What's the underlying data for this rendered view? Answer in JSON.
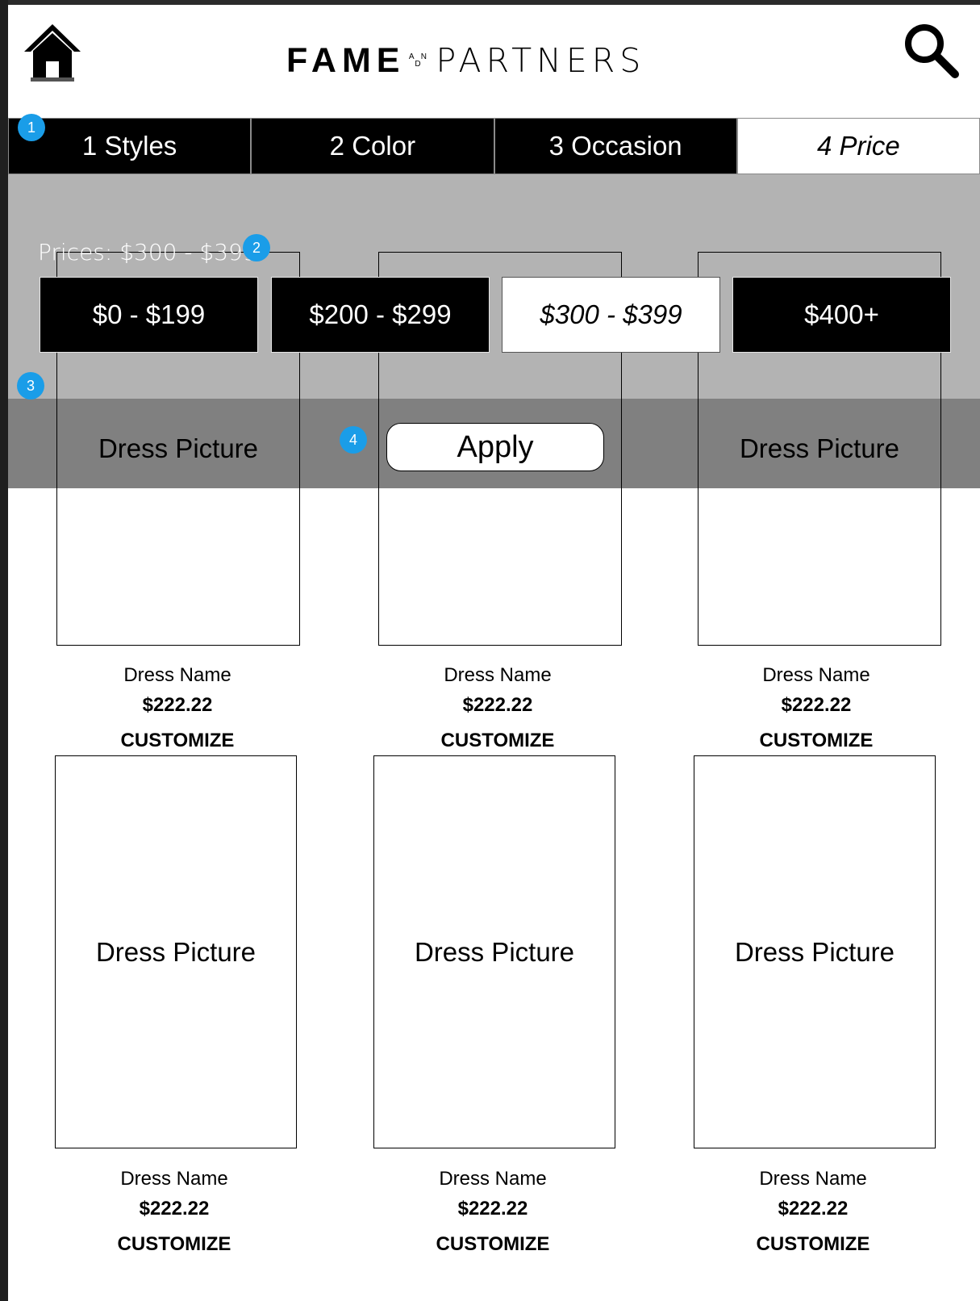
{
  "header": {
    "logo_left": "FAME",
    "logo_and": "A N D",
    "logo_right": "PARTNERS",
    "home_icon": "home-icon",
    "search_icon": "search-icon"
  },
  "tabs": [
    {
      "label": "1 Styles",
      "active": false
    },
    {
      "label": "2 Color",
      "active": false
    },
    {
      "label": "3 Occasion",
      "active": false
    },
    {
      "label": "4 Price",
      "active": true
    }
  ],
  "filter": {
    "prices_label": "Prices: $300 - $399",
    "options": [
      "$0 - $199",
      "$200 - $299",
      "$300 - $399",
      "$400+"
    ],
    "selected": "$300 - $399",
    "apply_label": "Apply"
  },
  "markers": [
    "1",
    "2",
    "3",
    "4"
  ],
  "products": [
    {
      "picture": "Dress Picture",
      "name": "Dress Name",
      "price": "$222.22",
      "action": "CUSTOMIZE"
    },
    {
      "picture": "Dress Picture",
      "name": "Dress Name",
      "price": "$222.22",
      "action": "CUSTOMIZE"
    },
    {
      "picture": "Dress Picture",
      "name": "Dress Name",
      "price": "$222.22",
      "action": "CUSTOMIZE"
    },
    {
      "picture": "Dress Picture",
      "name": "Dress Name",
      "price": "$222.22",
      "action": "CUSTOMIZE"
    },
    {
      "picture": "Dress Picture",
      "name": "Dress Name",
      "price": "$222.22",
      "action": "CUSTOMIZE"
    },
    {
      "picture": "Dress Picture",
      "name": "Dress Name",
      "price": "$222.22",
      "action": "CUSTOMIZE"
    }
  ],
  "colors": {
    "accent_marker": "#1a9de8",
    "filter_bg": "#b3b3b3",
    "apply_bar_bg": "#808080"
  }
}
